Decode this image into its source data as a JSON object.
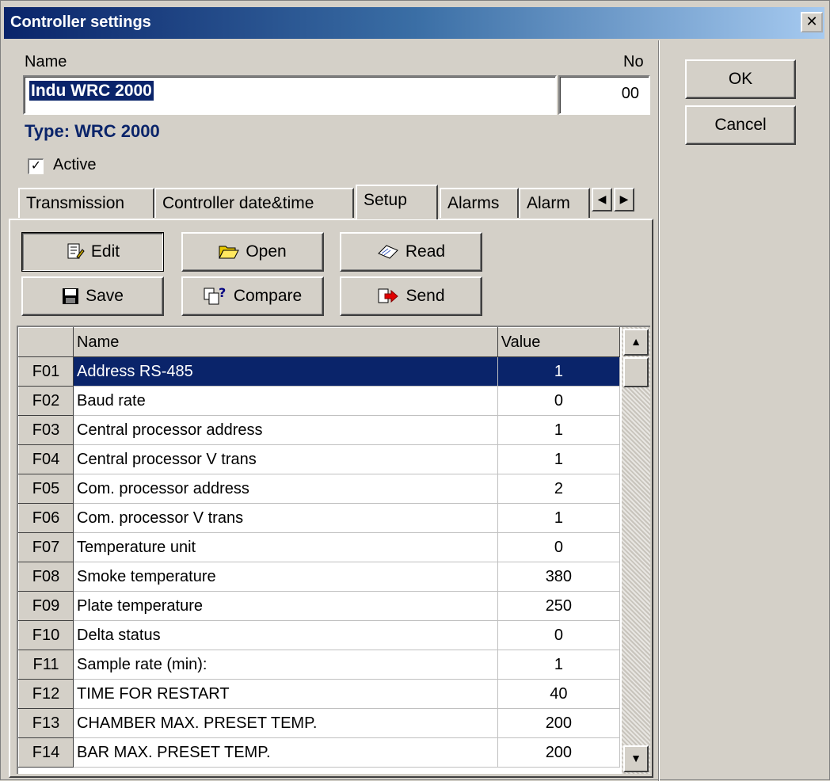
{
  "window": {
    "title": "Controller settings",
    "close": "✕"
  },
  "form": {
    "name_label": "Name",
    "no_label": "No",
    "name_value": "Indu WRC 2000",
    "no_value": "00",
    "type_text": "Type: WRC 2000",
    "active_label": "Active",
    "active_checked": true
  },
  "buttons": {
    "ok": "OK",
    "cancel": "Cancel"
  },
  "tabs": [
    {
      "label": "Transmission"
    },
    {
      "label": "Controller date&time"
    },
    {
      "label": "Setup",
      "active": true
    },
    {
      "label": "Alarms"
    },
    {
      "label": "Alarm"
    }
  ],
  "toolbar": {
    "edit": "Edit",
    "open": "Open",
    "read": "Read",
    "save": "Save",
    "compare": "Compare",
    "send": "Send"
  },
  "grid": {
    "headers": {
      "name": "Name",
      "value": "Value"
    },
    "rows": [
      {
        "code": "F01",
        "name": "Address RS-485",
        "value": "1"
      },
      {
        "code": "F02",
        "name": "Baud rate",
        "value": "0"
      },
      {
        "code": "F03",
        "name": "Central processor address",
        "value": "1"
      },
      {
        "code": "F04",
        "name": "Central processor V trans",
        "value": "1"
      },
      {
        "code": "F05",
        "name": "Com. processor address",
        "value": "2"
      },
      {
        "code": "F06",
        "name": "Com. processor V trans",
        "value": "1"
      },
      {
        "code": "F07",
        "name": "Temperature unit",
        "value": "0"
      },
      {
        "code": "F08",
        "name": "Smoke temperature",
        "value": "380"
      },
      {
        "code": "F09",
        "name": "Plate temperature",
        "value": "250"
      },
      {
        "code": "F10",
        "name": "Delta status",
        "value": "0"
      },
      {
        "code": "F11",
        "name": "Sample rate (min):",
        "value": "1"
      },
      {
        "code": "F12",
        "name": "TIME FOR RESTART",
        "value": "40"
      },
      {
        "code": "F13",
        "name": "CHAMBER MAX. PRESET TEMP.",
        "value": "200"
      },
      {
        "code": "F14",
        "name": "BAR MAX. PRESET TEMP.",
        "value": "200"
      }
    ]
  },
  "colors": {
    "titlebar": "#0a246a",
    "selection": "#0a246a",
    "face": "#d4d0c8"
  }
}
